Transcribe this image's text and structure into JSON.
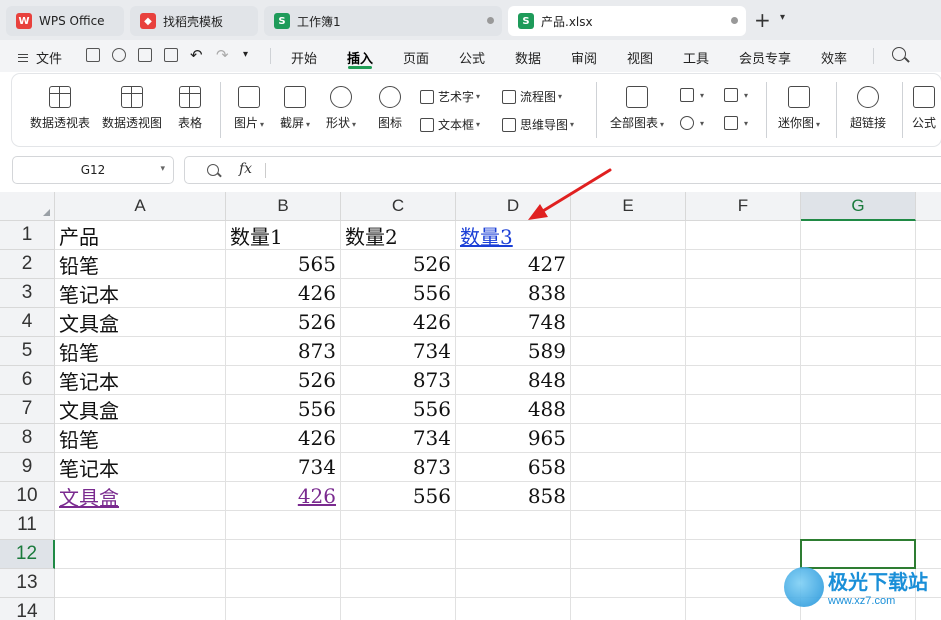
{
  "tabs": [
    {
      "label": "WPS Office",
      "icon": "wps-logo-icon",
      "color": "#e8413d"
    },
    {
      "label": "找稻壳模板",
      "icon": "docer-icon",
      "color": "#e8413d"
    },
    {
      "label": "工作簿1",
      "icon": "spreadsheet-icon",
      "color": "#1e9b5a"
    },
    {
      "label": "产品.xlsx",
      "icon": "spreadsheet-icon",
      "color": "#1e9b5a"
    }
  ],
  "menubar": {
    "file_label": "文件",
    "items": [
      "开始",
      "插入",
      "页面",
      "公式",
      "数据",
      "审阅",
      "视图",
      "工具",
      "会员专享",
      "效率"
    ],
    "active": "插入"
  },
  "ribbon": {
    "pivot_table": "数据透视表",
    "pivot_chart": "数据透视图",
    "table": "表格",
    "picture": "图片",
    "screenshot": "截屏",
    "shape": "形状",
    "icon": "图标",
    "art_text": "艺术字",
    "text_box": "文本框",
    "flowchart": "流程图",
    "mind_map": "思维导图",
    "all_charts": "全部图表",
    "sparkline": "迷你图",
    "hyperlink": "超链接",
    "formula": "公式"
  },
  "formula_bar": {
    "name_box": "G12",
    "fx_label": "fx",
    "content": ""
  },
  "sheet": {
    "columns": [
      "A",
      "B",
      "C",
      "D",
      "E",
      "F",
      "G"
    ],
    "rows": [
      "1",
      "2",
      "3",
      "4",
      "5",
      "6",
      "7",
      "8",
      "9",
      "10",
      "11",
      "12",
      "13",
      "14"
    ],
    "selected_column": "G",
    "selected_row": "12",
    "data": [
      [
        "产品",
        "数量1",
        "数量2",
        "数量3"
      ],
      [
        "铅笔",
        "565",
        "526",
        "427"
      ],
      [
        "笔记本",
        "426",
        "556",
        "838"
      ],
      [
        "文具盒",
        "526",
        "426",
        "748"
      ],
      [
        "铅笔",
        "873",
        "734",
        "589"
      ],
      [
        "笔记本",
        "526",
        "873",
        "848"
      ],
      [
        "文具盒",
        "556",
        "556",
        "488"
      ],
      [
        "铅笔",
        "426",
        "734",
        "965"
      ],
      [
        "笔记本",
        "734",
        "873",
        "658"
      ],
      [
        "文具盒",
        "426",
        "556",
        "858"
      ]
    ],
    "hyperlinks": {
      "D1": "blue",
      "A10": "purple",
      "B10": "purple"
    }
  },
  "watermark": {
    "title": "极光下载站",
    "url": "www.xz7.com"
  },
  "colors": {
    "accent": "#1f9d55",
    "selection": "#2e7d32",
    "arrow": "#e02020",
    "link_blue": "#1b3fd6",
    "link_visited": "#7a2a8f"
  }
}
